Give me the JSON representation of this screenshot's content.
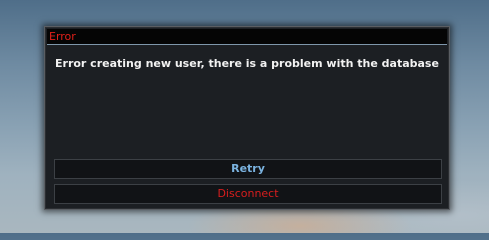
{
  "dialog": {
    "title": "Error",
    "message": "Error creating new user, there is a problem with the database",
    "buttons": {
      "retry": "Retry",
      "disconnect": "Disconnect"
    }
  },
  "colors": {
    "title_text": "#e0201a",
    "retry_text": "#7bb3e0",
    "disconnect_text": "#d71e1e",
    "dialog_bg": "#1c1f23",
    "title_underline": "#7f97ab"
  }
}
